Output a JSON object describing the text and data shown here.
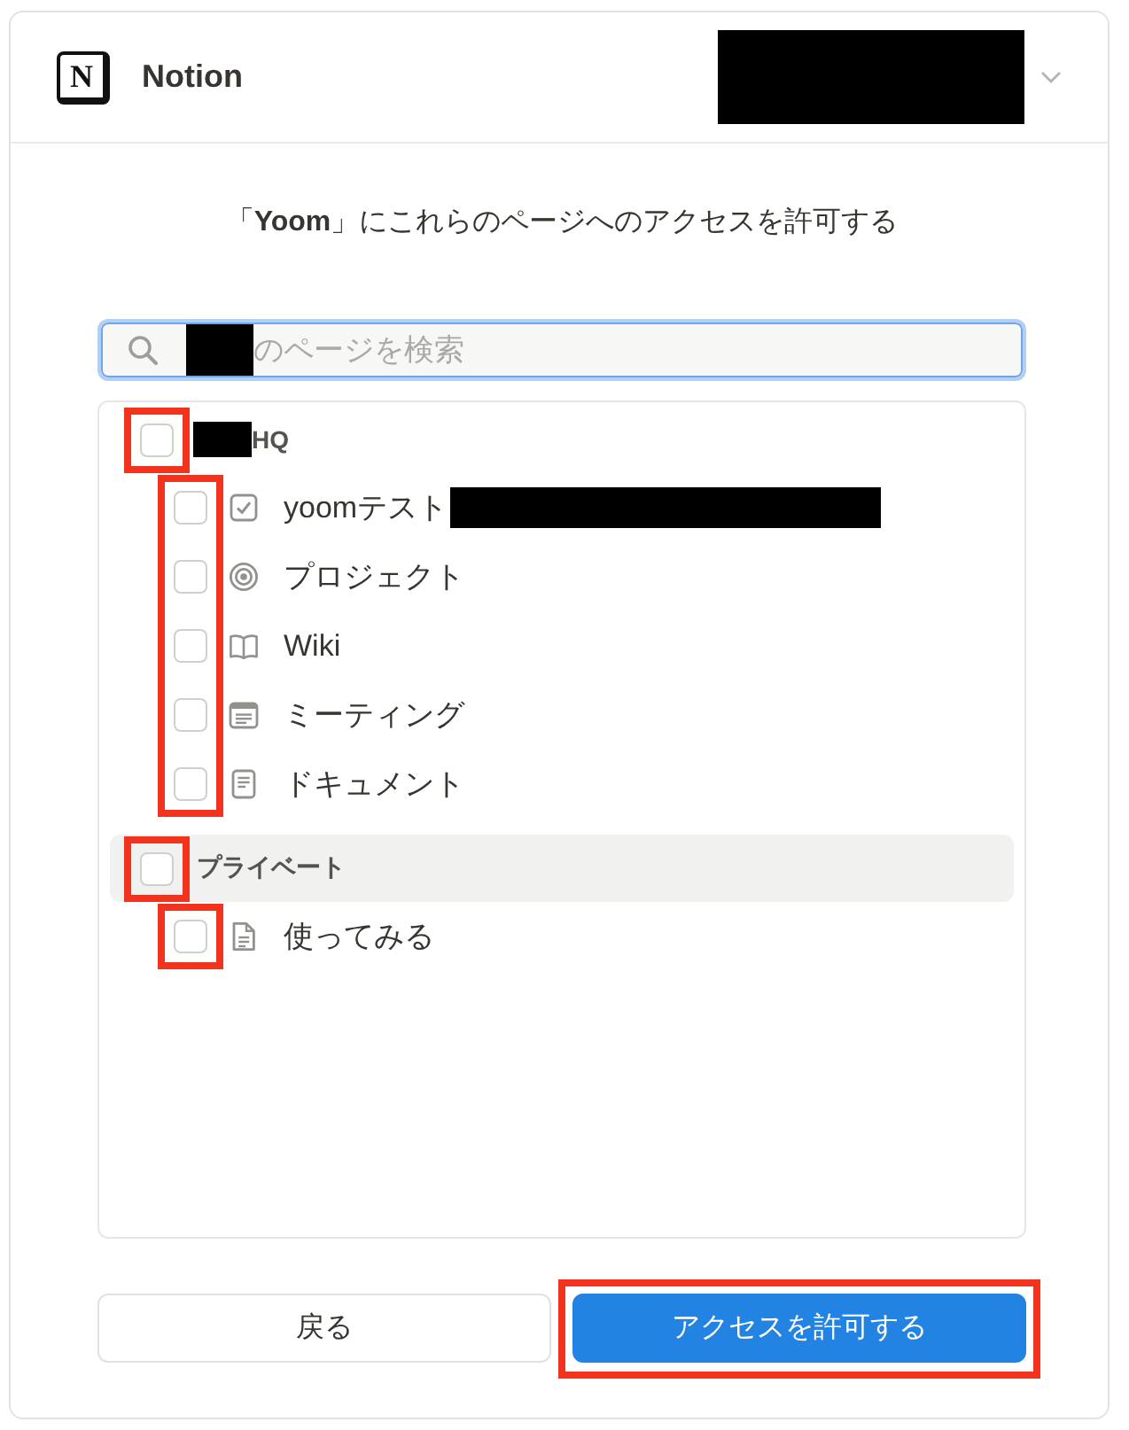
{
  "header": {
    "logo": "N",
    "app_name": "Notion",
    "account": {
      "redacted": true
    }
  },
  "prompt": "「**Yoom**」にこれらのページへのアクセスを許可する",
  "search": {
    "prefix_redacted": true,
    "placeholder": "のページを検索"
  },
  "sections": [
    {
      "name": "HQ",
      "prefix_redacted": true,
      "checked": false,
      "hovered": false,
      "highlighted": true,
      "children_highlighted": true,
      "pages": [
        {
          "kind": "checklist",
          "title": "yoomテスト",
          "suffix_redacted": true,
          "checked": false
        },
        {
          "kind": "target",
          "title": "プロジェクト",
          "checked": false
        },
        {
          "kind": "book",
          "title": "Wiki",
          "checked": false
        },
        {
          "kind": "notes",
          "title": "ミーティング",
          "checked": false
        },
        {
          "kind": "document",
          "title": "ドキュメント",
          "checked": false
        }
      ]
    },
    {
      "name": "プライベート",
      "checked": false,
      "hovered": true,
      "highlighted": true,
      "children_highlighted": true,
      "pages": [
        {
          "kind": "file",
          "title": "使ってみる",
          "checked": false
        }
      ]
    }
  ],
  "buttons": [
    {
      "kind": "secondary",
      "label": "戻る",
      "highlighted": false
    },
    {
      "kind": "primary",
      "label": "アクセスを許可する",
      "highlighted": true
    }
  ]
}
